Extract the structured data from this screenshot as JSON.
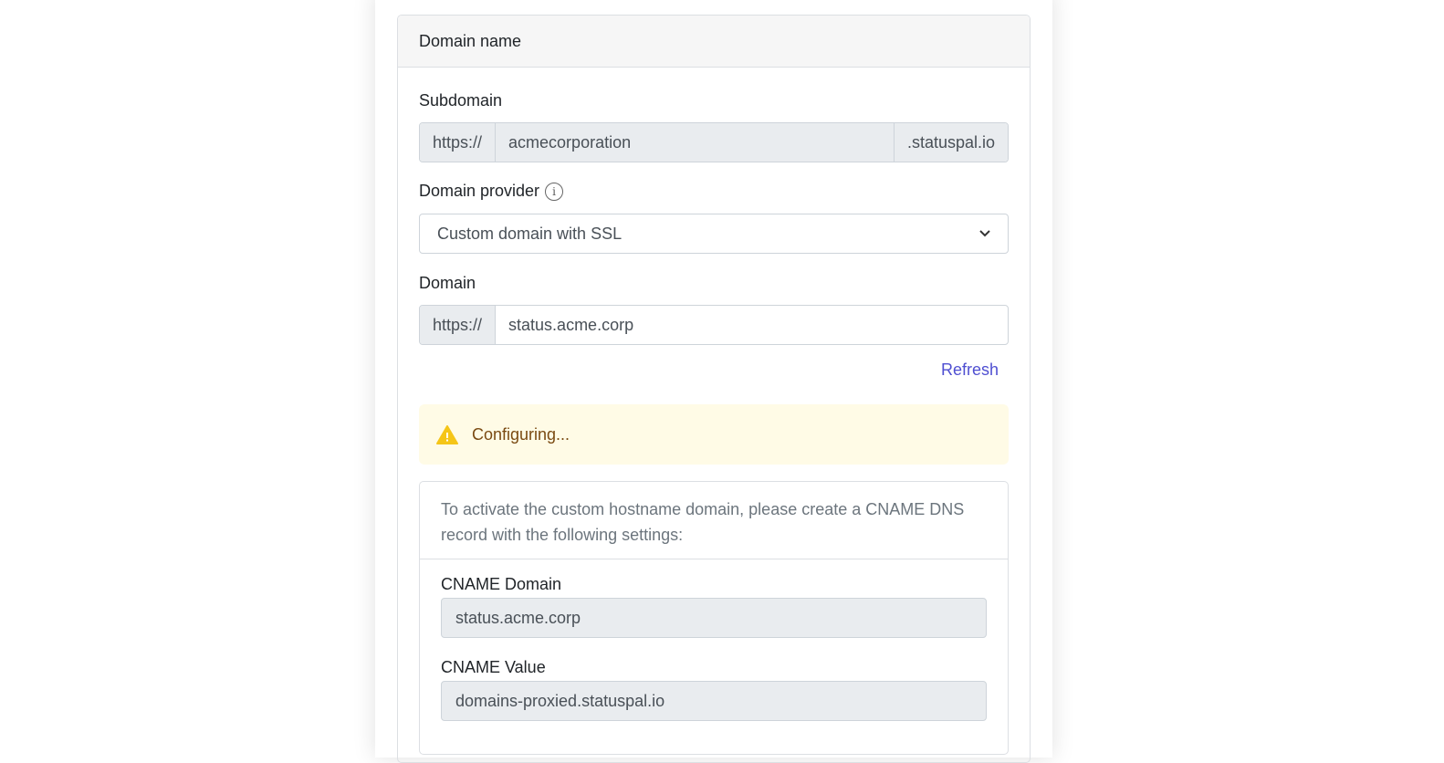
{
  "card": {
    "title": "Domain name"
  },
  "subdomain": {
    "label": "Subdomain",
    "prefix": "https://",
    "value": "acmecorporation",
    "suffix": ".statuspal.io"
  },
  "provider": {
    "label": "Domain provider",
    "info_icon": "i",
    "selected": "Custom domain with SSL"
  },
  "domain": {
    "label": "Domain",
    "prefix": "https://",
    "value": "status.acme.corp"
  },
  "refresh_label": "Refresh",
  "alert": {
    "text": "Configuring...",
    "color": "#fffbe6"
  },
  "instructions": {
    "text": "To activate the custom hostname domain, please create a CNAME DNS record with the following settings:",
    "cname_domain_label": "CNAME Domain",
    "cname_domain": "status.acme.corp",
    "cname_value_label": "CNAME Value",
    "cname_value": "domains-proxied.statuspal.io"
  }
}
